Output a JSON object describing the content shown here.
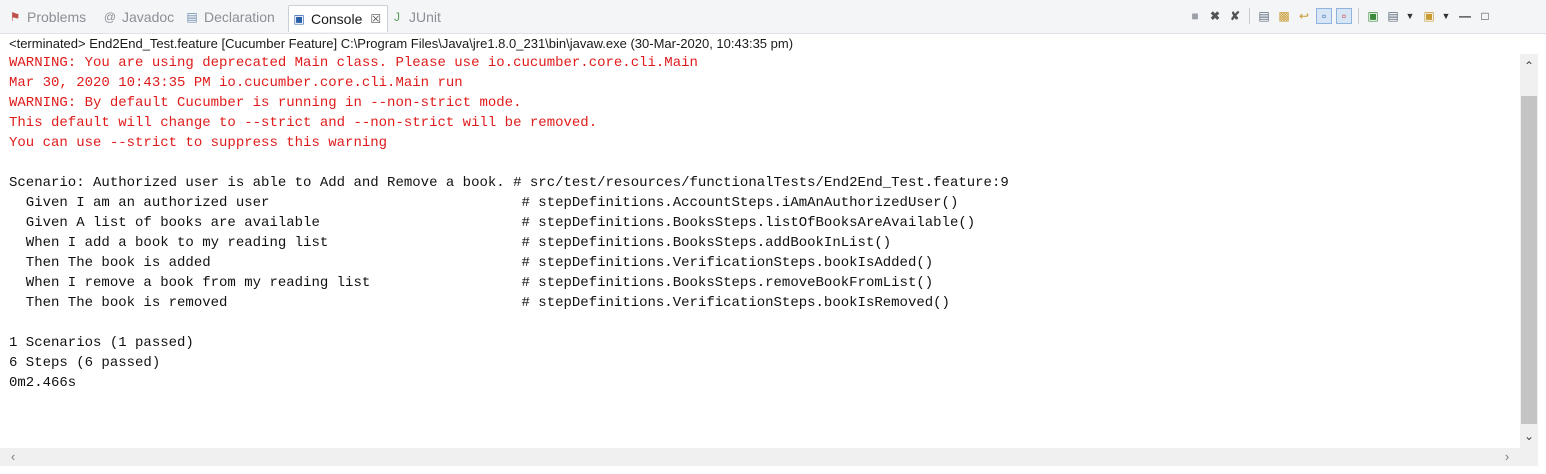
{
  "tabs": [
    {
      "label": "Problems",
      "icon": "problems-icon",
      "active": false
    },
    {
      "label": "Javadoc",
      "icon": "javadoc-icon",
      "active": false
    },
    {
      "label": "Declaration",
      "icon": "declaration-icon",
      "active": false
    },
    {
      "label": "Console",
      "icon": "console-icon",
      "active": true,
      "close": "☒"
    },
    {
      "label": "JUnit",
      "icon": "junit-icon",
      "active": false
    }
  ],
  "toolbar": {
    "icons": [
      "terminate-icon",
      "remove-launch-icon",
      "remove-all-terminated-icon",
      "clear-console-icon",
      "scroll-lock-icon",
      "word-wrap-icon",
      "show-on-stdout-icon",
      "show-on-stderr-icon",
      "pin-console-icon",
      "display-console-icon",
      "open-console-icon",
      "minimize-icon",
      "maximize-icon"
    ]
  },
  "description": "<terminated> End2End_Test.feature [Cucumber Feature] C:\\Program Files\\Java\\jre1.8.0_231\\bin\\javaw.exe (30-Mar-2020, 10:43:35 pm)",
  "console_lines": [
    {
      "text": "WARNING: You are using deprecated Main class. Please use io.cucumber.core.cli.Main",
      "type": "err"
    },
    {
      "text": "Mar 30, 2020 10:43:35 PM io.cucumber.core.cli.Main run",
      "type": "err"
    },
    {
      "text": "WARNING: By default Cucumber is running in --non-strict mode.",
      "type": "err"
    },
    {
      "text": "This default will change to --strict and --non-strict will be removed.",
      "type": "err"
    },
    {
      "text": "You can use --strict to suppress this warning",
      "type": "err"
    },
    {
      "text": "",
      "type": "out"
    },
    {
      "text": "Scenario: Authorized user is able to Add and Remove a book. # src/test/resources/functionalTests/End2End_Test.feature:9",
      "type": "out"
    },
    {
      "text": "  Given I am an authorized user                              # stepDefinitions.AccountSteps.iAmAnAuthorizedUser()",
      "type": "out"
    },
    {
      "text": "  Given A list of books are available                        # stepDefinitions.BooksSteps.listOfBooksAreAvailable()",
      "type": "out"
    },
    {
      "text": "  When I add a book to my reading list                       # stepDefinitions.BooksSteps.addBookInList()",
      "type": "out"
    },
    {
      "text": "  Then The book is added                                     # stepDefinitions.VerificationSteps.bookIsAdded()",
      "type": "out"
    },
    {
      "text": "  When I remove a book from my reading list                  # stepDefinitions.BooksSteps.removeBookFromList()",
      "type": "out"
    },
    {
      "text": "  Then The book is removed                                   # stepDefinitions.VerificationSteps.bookIsRemoved()",
      "type": "out"
    },
    {
      "text": "",
      "type": "out"
    },
    {
      "text": "1 Scenarios (1 passed)",
      "type": "out"
    },
    {
      "text": "6 Steps (6 passed)",
      "type": "out"
    },
    {
      "text": "0m2.466s",
      "type": "out"
    }
  ],
  "colors": {
    "stderr": "#e01b1b",
    "stdout": "#111111"
  }
}
